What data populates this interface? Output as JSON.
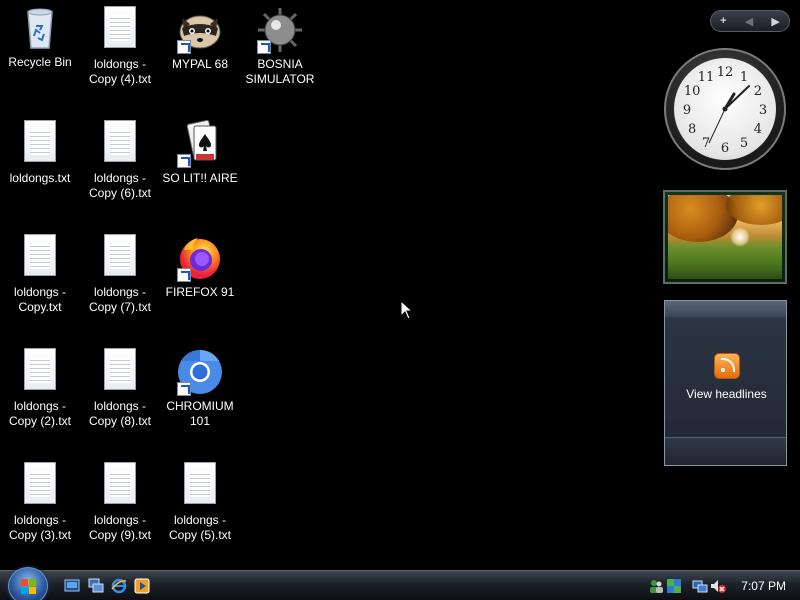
{
  "desktop": {
    "icons": [
      {
        "label": "Recycle Bin",
        "icon": "recycle-bin-icon"
      },
      {
        "label": "loldongs - Copy (4).txt",
        "icon": "text-file-icon"
      },
      {
        "label": "MYPAL 68",
        "icon": "mypal-raccoon-icon"
      },
      {
        "label": "BOSNIA SIMULATOR",
        "icon": "mine-icon"
      },
      {
        "label": "loldongs.txt",
        "icon": "text-file-icon"
      },
      {
        "label": "loldongs - Copy (6).txt",
        "icon": "text-file-icon"
      },
      {
        "label": "SO LIT!! AIRE",
        "icon": "solitaire-cards-icon"
      },
      {
        "label": "loldongs - Copy.txt",
        "icon": "text-file-icon"
      },
      {
        "label": "loldongs - Copy (7).txt",
        "icon": "text-file-icon"
      },
      {
        "label": "FIREFOX 91",
        "icon": "firefox-icon"
      },
      {
        "label": "loldongs - Copy (2).txt",
        "icon": "text-file-icon"
      },
      {
        "label": "loldongs - Copy (8).txt",
        "icon": "text-file-icon"
      },
      {
        "label": "CHROMIUM 101",
        "icon": "chromium-icon"
      },
      {
        "label": "loldongs - Copy (3).txt",
        "icon": "text-file-icon"
      },
      {
        "label": "loldongs - Copy (9).txt",
        "icon": "text-file-icon"
      },
      {
        "label": "loldongs - Copy (5).txt",
        "icon": "text-file-icon"
      }
    ]
  },
  "sidebar": {
    "toolbar": {
      "add": "+",
      "prev": "◀",
      "next": "▶"
    },
    "clock_numbers": [
      "12",
      "1",
      "2",
      "3",
      "4",
      "5",
      "6",
      "7",
      "8",
      "9",
      "10",
      "11"
    ],
    "feed_label": "View headlines"
  },
  "taskbar": {
    "time": "7:07 PM",
    "colors": {
      "start_orb": "#2c5ba0",
      "taskbar": "#1d2229"
    }
  }
}
